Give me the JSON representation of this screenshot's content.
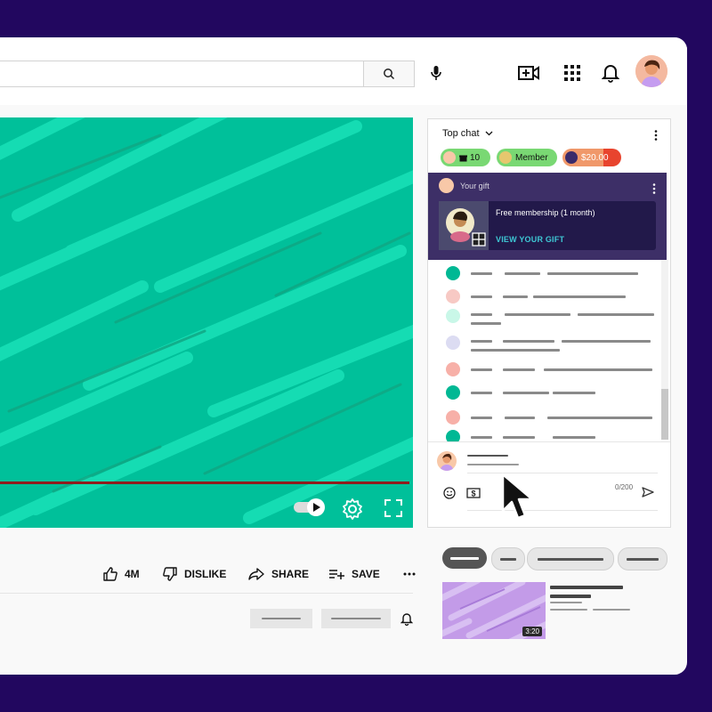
{
  "chat": {
    "title": "Top chat",
    "chips": [
      {
        "label": "10",
        "color": "#6ad46a"
      },
      {
        "label": "Member",
        "color": "#6ad46a"
      },
      {
        "label": "$20.00",
        "color": "#f08a5a"
      }
    ],
    "gift": {
      "label": "Your gift",
      "title": "Free membership (1 month)",
      "link": "VIEW YOUR GIFT"
    },
    "char_count": "0/200",
    "message_dot_colors": [
      "#00b894",
      "#f7c9c4",
      "#c9f7e8",
      "#dcdcf2",
      "#f7b0a8",
      "#00b894",
      "#f7b0a8",
      "#00b894"
    ]
  },
  "actions": {
    "like_count": "4M",
    "dislike_label": "DISLIKE",
    "share_label": "SHARE",
    "save_label": "SAVE"
  },
  "recommendation": {
    "duration": "3:20"
  },
  "colors": {
    "background": "#22075f",
    "player": "#00c09a",
    "gift_panel": "#3d2f67",
    "gift_link": "#3ec8d4",
    "progress": "#8f1d1d"
  }
}
